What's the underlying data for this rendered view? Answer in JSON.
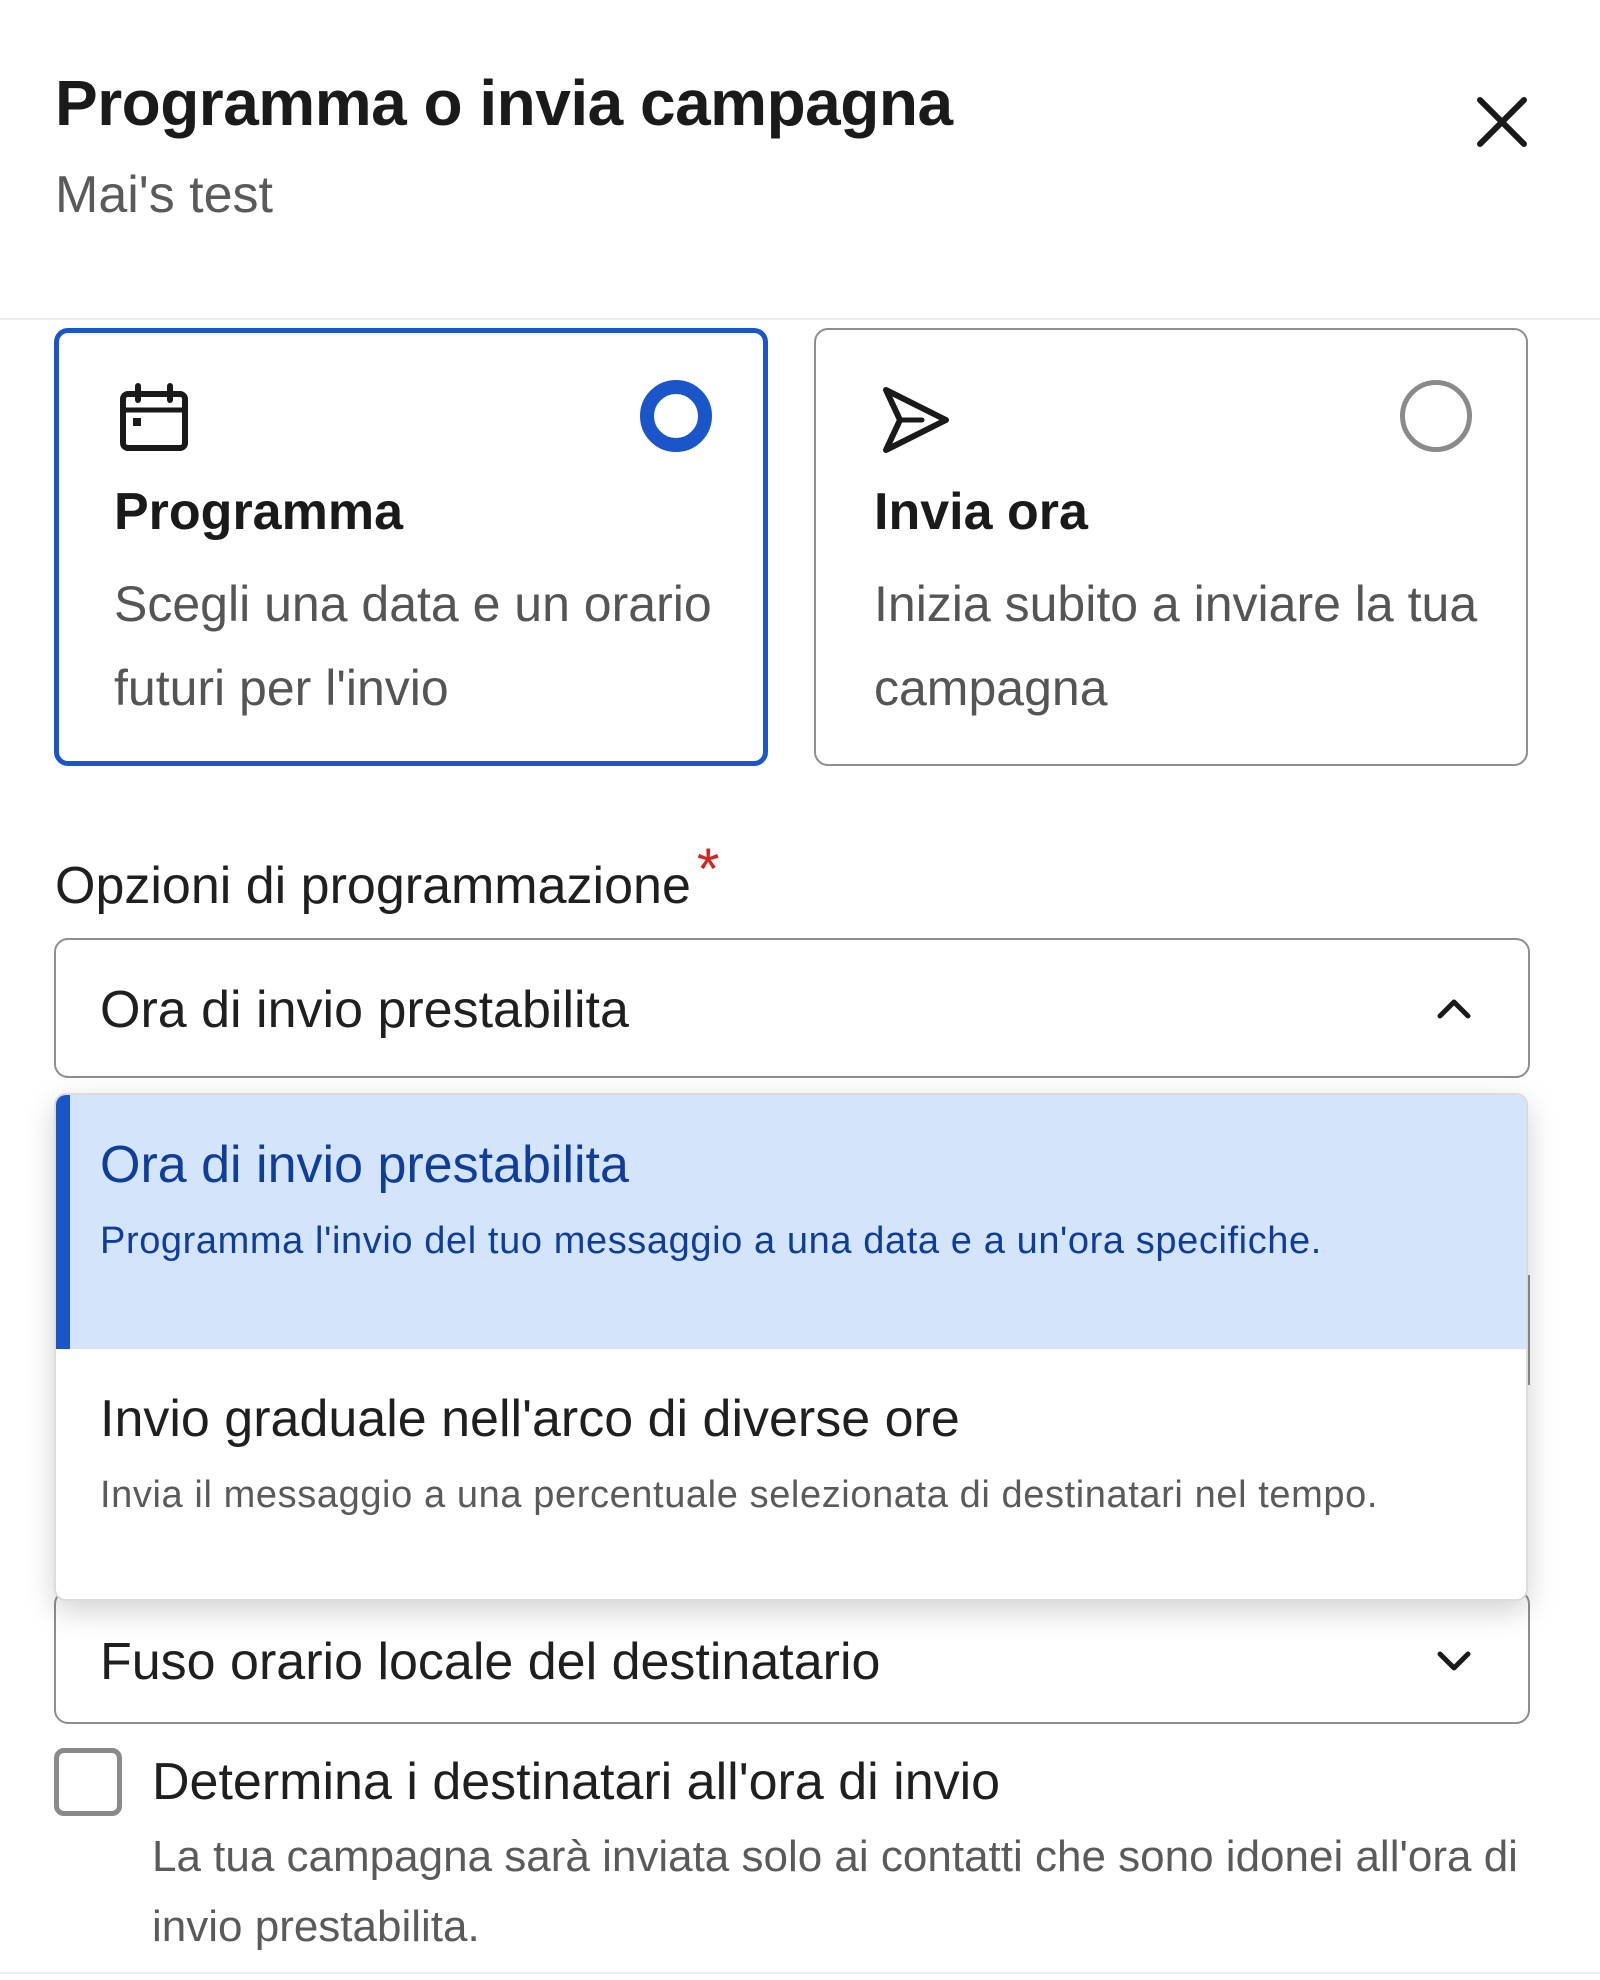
{
  "dialog": {
    "title": "Programma o invia campagna",
    "subtitle": "Mai's test"
  },
  "send_mode": {
    "options": [
      {
        "title": "Programma",
        "description": "Scegli una data e un orario futuri per l'invio",
        "selected": true,
        "icon": "calendar-icon"
      },
      {
        "title": "Invia ora",
        "description": "Inizia subito a inviare la tua campagna",
        "selected": false,
        "icon": "send-icon"
      }
    ]
  },
  "schedule_options": {
    "label": "Opzioni di programmazione",
    "required_marker": "*",
    "selected_value": "Ora di invio prestabilita",
    "expanded": true,
    "options": [
      {
        "title": "Ora di invio prestabilita",
        "description": "Programma l'invio del tuo messaggio a una data e a un'ora specifiche.",
        "active": true
      },
      {
        "title": "Invio graduale nell'arco di diverse ore",
        "description": "Invia il messaggio a una percentuale selezionata di destinatari nel tempo.",
        "active": false
      }
    ]
  },
  "timezone": {
    "selected_value": "Fuso orario locale del destinatario"
  },
  "recipients_check": {
    "label": "Determina i destinatari all'ora di invio",
    "description": "La tua campagna sarà inviata solo ai contatti che sono idonei all'ora di invio prestabilita.",
    "checked": false
  },
  "colors": {
    "accent": "#1a56c9",
    "selected_option_bg": "#d4e5fb",
    "required": "#d42525"
  }
}
